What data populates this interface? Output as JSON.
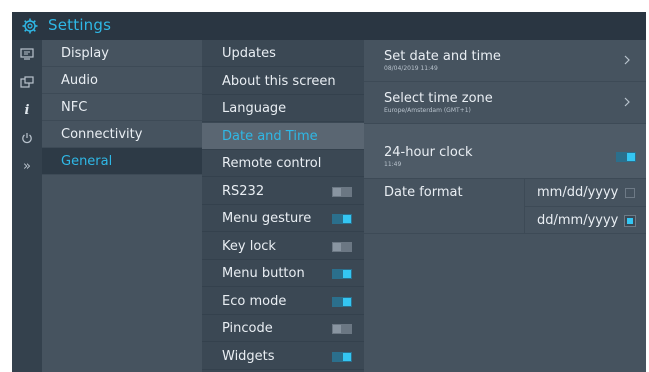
{
  "header": {
    "title": "Settings",
    "icon": "gear-icon",
    "accent": "#2fb8e6"
  },
  "rail_icons": [
    "display-icon",
    "audio-icon",
    "info-icon",
    "power-icon",
    "chevron-double-right-icon"
  ],
  "categories": [
    {
      "label": "Display",
      "selected": false
    },
    {
      "label": "Audio",
      "selected": false
    },
    {
      "label": "NFC",
      "selected": false
    },
    {
      "label": "Connectivity",
      "selected": false
    },
    {
      "label": "General",
      "selected": true
    }
  ],
  "general_items": [
    {
      "label": "Updates"
    },
    {
      "label": "About this screen"
    },
    {
      "label": "Language"
    },
    {
      "label": "Date and Time",
      "selected": true
    },
    {
      "label": "Remote control"
    },
    {
      "label": "RS232",
      "toggle": false
    },
    {
      "label": "Menu gesture",
      "toggle": true
    },
    {
      "label": "Key lock",
      "toggle": false
    },
    {
      "label": "Menu button",
      "toggle": true
    },
    {
      "label": "Eco mode",
      "toggle": true
    },
    {
      "label": "Pincode",
      "toggle": false
    },
    {
      "label": "Widgets",
      "toggle": true
    }
  ],
  "date_time": {
    "set_date_time": {
      "label": "Set date and time",
      "value": "08/04/2019 11:49"
    },
    "time_zone": {
      "label": "Select time zone",
      "value": "Europe/Amsterdam (GMT+1)"
    },
    "clock_24h": {
      "label": "24-hour clock",
      "value": "11:49",
      "enabled": true
    },
    "date_format": {
      "label": "Date format",
      "options": [
        {
          "label": "mm/dd/yyyy",
          "checked": false
        },
        {
          "label": "dd/mm/yyyy",
          "checked": true
        }
      ]
    }
  }
}
